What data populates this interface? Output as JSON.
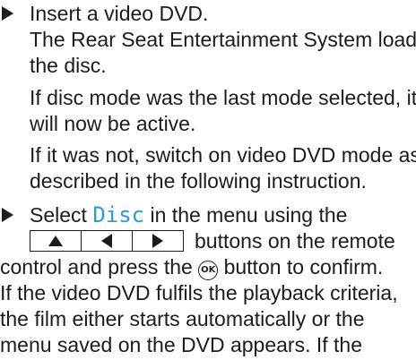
{
  "instructions": {
    "step1": {
      "lines": [
        "Insert a video DVD.",
        "The Rear Seat Entertainment System loads",
        "the disc.",
        "If disc mode was the last mode selected, it",
        "will now be active.",
        "If it was not, switch on video DVD mode as",
        "described in the following instruction."
      ]
    },
    "step2": {
      "select_prefix": "Select ",
      "menu_item": "Disc",
      "select_suffix": " in the menu using the",
      "buttons_suffix": "buttons on the remote",
      "control_prefix": "control and press the",
      "ok_label": "OK",
      "control_suffix": "button to confirm.",
      "lines": [
        "If the video DVD fulfils the playback criteria,",
        "the film either starts automatically or the",
        "menu saved on the DVD appears. If the"
      ]
    }
  },
  "icons": {
    "bullet": "right-triangle-bullet",
    "remote_buttons": [
      "up-arrow-button",
      "left-arrow-button",
      "right-arrow-button"
    ],
    "ok_button": "ok-button"
  },
  "colors": {
    "text": "#1c1c1c",
    "highlight": "#2a9bd6"
  }
}
